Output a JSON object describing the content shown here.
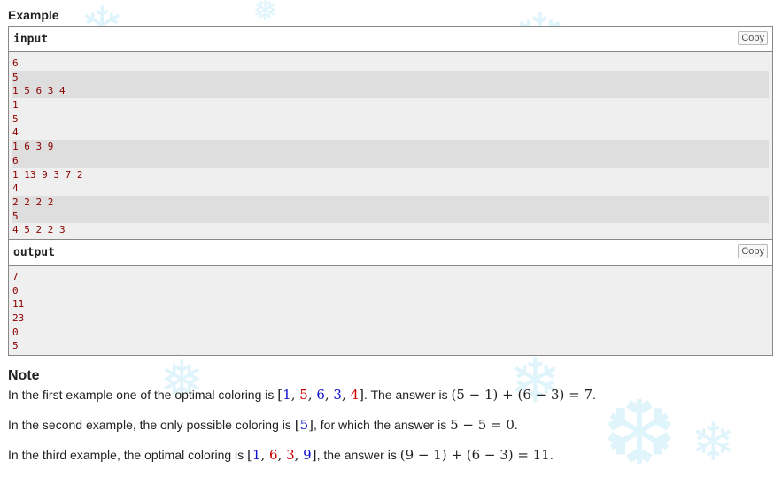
{
  "example": {
    "title": "Example",
    "input_label": "input",
    "output_label": "output",
    "copy_label": "Copy",
    "input_lines": [
      "6",
      "5",
      "1 5 6 3 4",
      "1",
      "5",
      "4",
      "1 6 3 9",
      "6",
      "1 13 9 3 7 2",
      "4",
      "2 2 2 2",
      "5",
      "4 5 2 2 3"
    ],
    "output_lines": [
      "7",
      "0",
      "11",
      "23",
      "0",
      "5"
    ]
  },
  "note": {
    "title": "Note",
    "p1_pre": "In the first example one of the optimal coloring is ",
    "p1_mid": ". The answer is ",
    "p1_expr": "(5 − 1) + (6 − 3) = 7",
    "p1_end": ".",
    "p1_set": [
      "1",
      "5",
      "6",
      "3",
      "4"
    ],
    "p2_pre": "In the second example, the only possible coloring is ",
    "p2_set": [
      "5"
    ],
    "p2_mid": ", for which the answer is ",
    "p2_expr": "5 − 5 = 0",
    "p2_end": ".",
    "p3_pre": "In the third example, the optimal coloring is ",
    "p3_set": [
      "1",
      "6",
      "3",
      "9"
    ],
    "p3_mid": ", the answer is ",
    "p3_expr": "(9 − 1) + (6 − 3) = 11",
    "p3_end": "."
  },
  "colors": {
    "accent_red": "#cc0000",
    "accent_blue": "#1010cc",
    "sample_text": "#8b0000"
  },
  "icons": [
    "snowflake-icon"
  ]
}
